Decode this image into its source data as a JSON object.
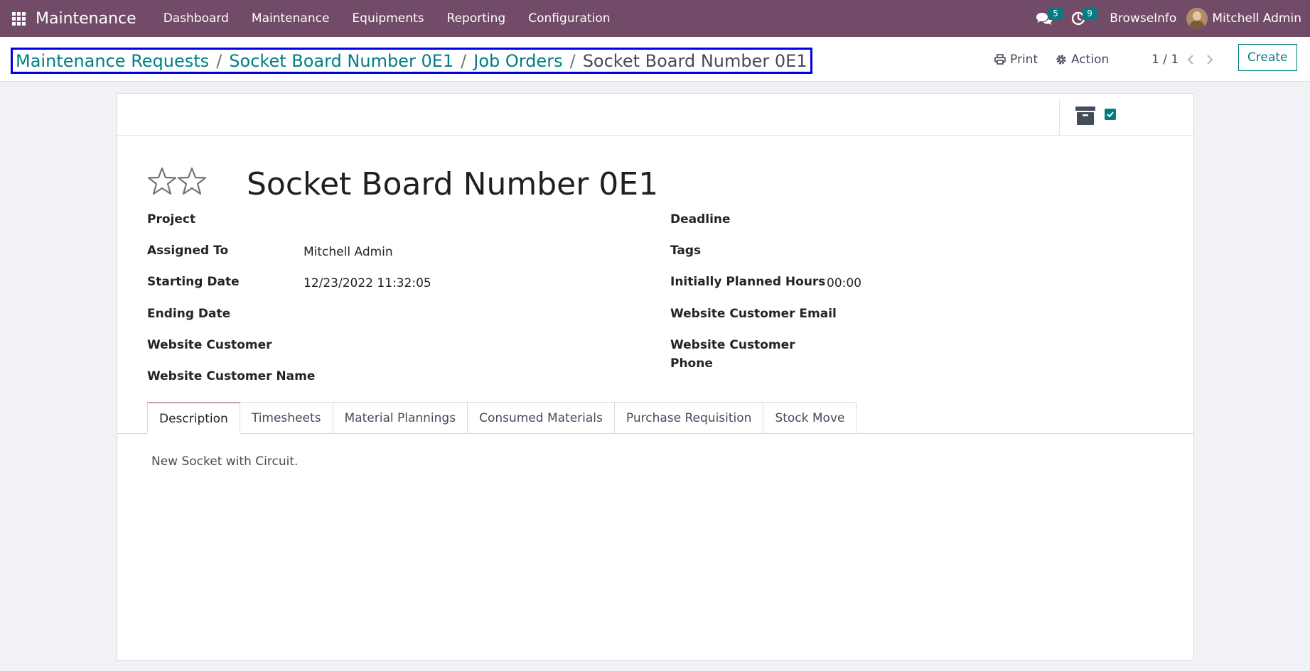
{
  "navbar": {
    "app_name": "Maintenance",
    "menu": [
      "Dashboard",
      "Maintenance",
      "Equipments",
      "Reporting",
      "Configuration"
    ],
    "messages_count": "5",
    "activities_count": "9",
    "company": "BrowseInfo",
    "user": "Mitchell Admin"
  },
  "breadcrumb": {
    "items": [
      "Maintenance Requests",
      "Socket Board Number 0E1",
      "Job Orders"
    ],
    "current": "Socket Board Number 0E1",
    "separator": "/"
  },
  "control_panel": {
    "print_label": "Print",
    "action_label": "Action",
    "pager": "1 / 1",
    "create_label": "Create"
  },
  "record": {
    "title": "Socket Board Number 0E1",
    "priority_stars": 2,
    "priority_value": 0,
    "left_fields": [
      {
        "label": "Project",
        "value": ""
      },
      {
        "label": "Assigned To",
        "value": "Mitchell Admin"
      },
      {
        "label": "Starting Date",
        "value": "12/23/2022 11:32:05"
      },
      {
        "label": "Ending Date",
        "value": ""
      },
      {
        "label": "Website Customer",
        "value": ""
      },
      {
        "label": "Website Customer Name",
        "value": ""
      }
    ],
    "right_fields": [
      {
        "label": "Deadline",
        "value": ""
      },
      {
        "label": "Tags",
        "value": ""
      },
      {
        "label": "Initially Planned Hours",
        "value": "00:00"
      },
      {
        "label": "Website Customer Email",
        "value": ""
      },
      {
        "label": "Website Customer",
        "value": ""
      },
      {
        "label": "Phone",
        "value": ""
      }
    ]
  },
  "tabs": [
    "Description",
    "Timesheets",
    "Material Plannings",
    "Consumed Materials",
    "Purchase Requisition",
    "Stock Move"
  ],
  "active_tab": "Description",
  "description": "New Socket with Circuit.",
  "colors": {
    "navbar": "#714b67",
    "accent": "#017e84",
    "highlight_border": "#0000e0"
  }
}
